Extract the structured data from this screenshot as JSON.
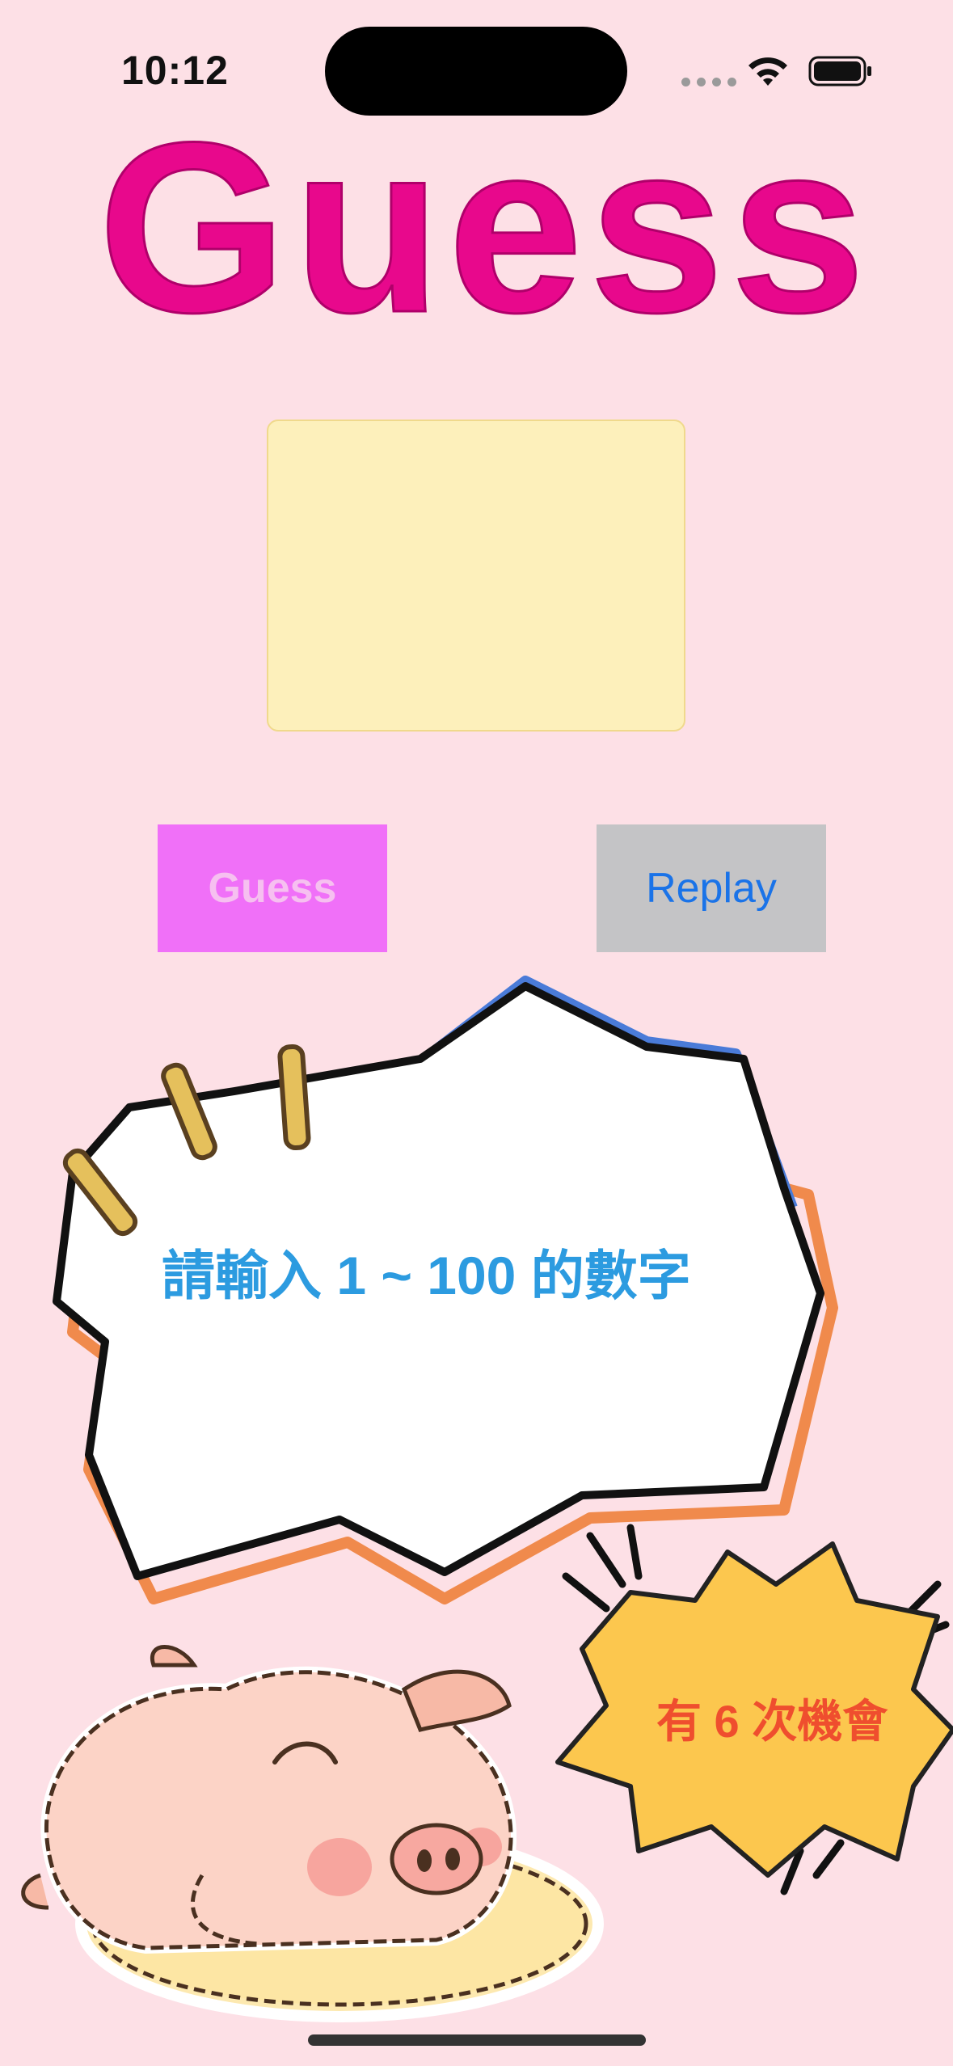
{
  "status_bar": {
    "time": "10:12"
  },
  "header": {
    "title": "Guess",
    "title_color": "#e8088c"
  },
  "result": {
    "text": ""
  },
  "buttons": {
    "guess_label": "Guess",
    "replay_label": "Replay"
  },
  "prompt": {
    "text": "請輸入 1 ~ 100 的數字"
  },
  "chances": {
    "text": "有 6 次機會"
  },
  "colors": {
    "background": "#fde0e6",
    "result_box": "#fdf0bb",
    "guess_button": "#f070f8",
    "replay_button": "#c4c4c6",
    "prompt_text": "#2c9be0",
    "chance_text": "#ef4e2e",
    "chance_burst": "#fcc74e"
  },
  "icons": {
    "wifi": "wifi-icon",
    "battery": "battery-icon",
    "pig": "pig-illustration"
  }
}
